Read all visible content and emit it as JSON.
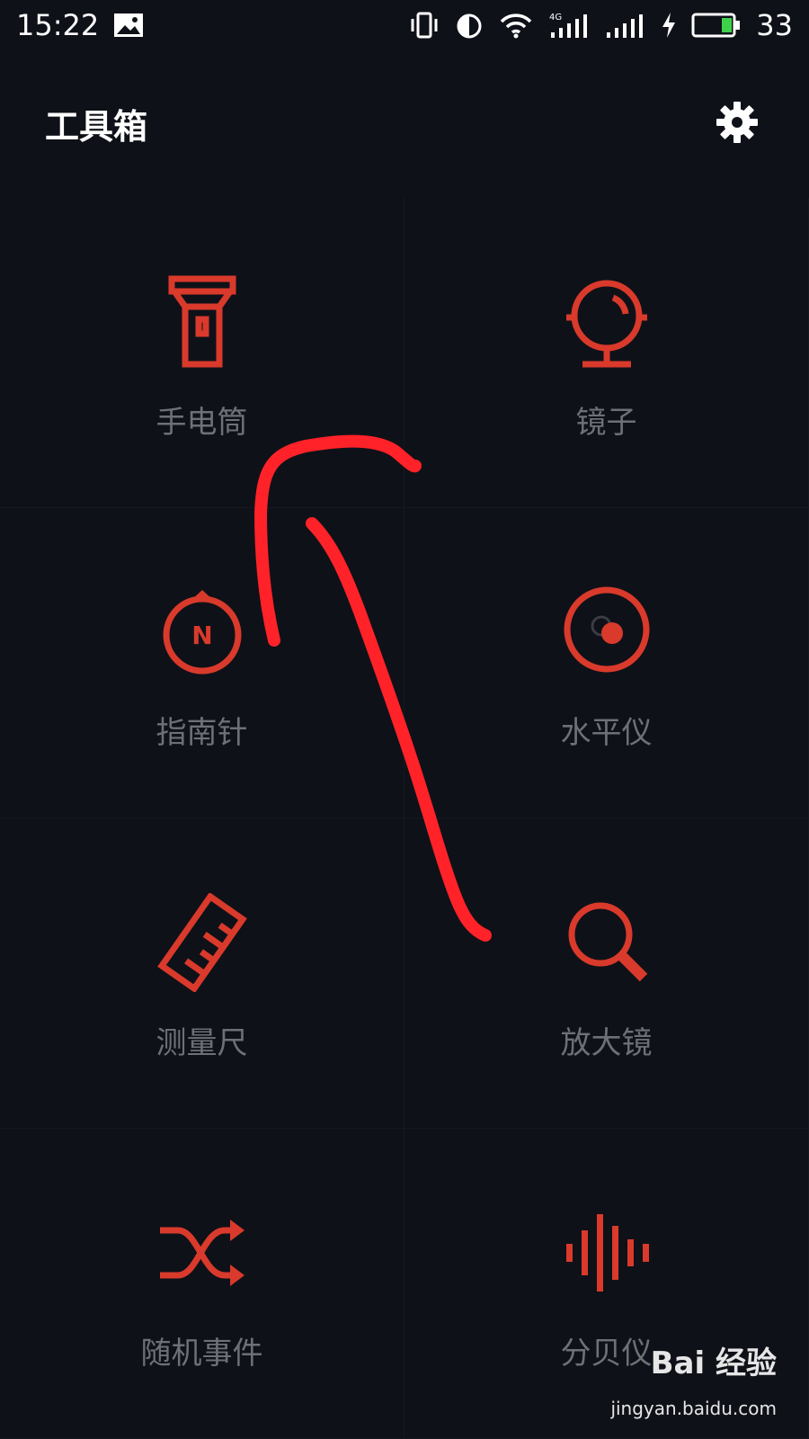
{
  "status": {
    "time": "15:22",
    "battery": "33",
    "network": "4G"
  },
  "header": {
    "title": "工具箱"
  },
  "tools": [
    {
      "label": "手电筒",
      "icon": "flashlight-icon"
    },
    {
      "label": "镜子",
      "icon": "mirror-icon"
    },
    {
      "label": "指南针",
      "icon": "compass-icon"
    },
    {
      "label": "水平仪",
      "icon": "level-icon"
    },
    {
      "label": "测量尺",
      "icon": "ruler-icon"
    },
    {
      "label": "放大镜",
      "icon": "magnifier-icon"
    },
    {
      "label": "随机事件",
      "icon": "shuffle-icon"
    },
    {
      "label": "分贝仪",
      "icon": "decibel-icon"
    }
  ],
  "compass_letter": "N",
  "watermark": {
    "brand": "Bai 经验",
    "url": "jingyan.baidu.com"
  },
  "colors": {
    "background": "#0f1118",
    "accent": "#d93a2b",
    "label": "#6e7078",
    "scribble": "#ff2228"
  }
}
